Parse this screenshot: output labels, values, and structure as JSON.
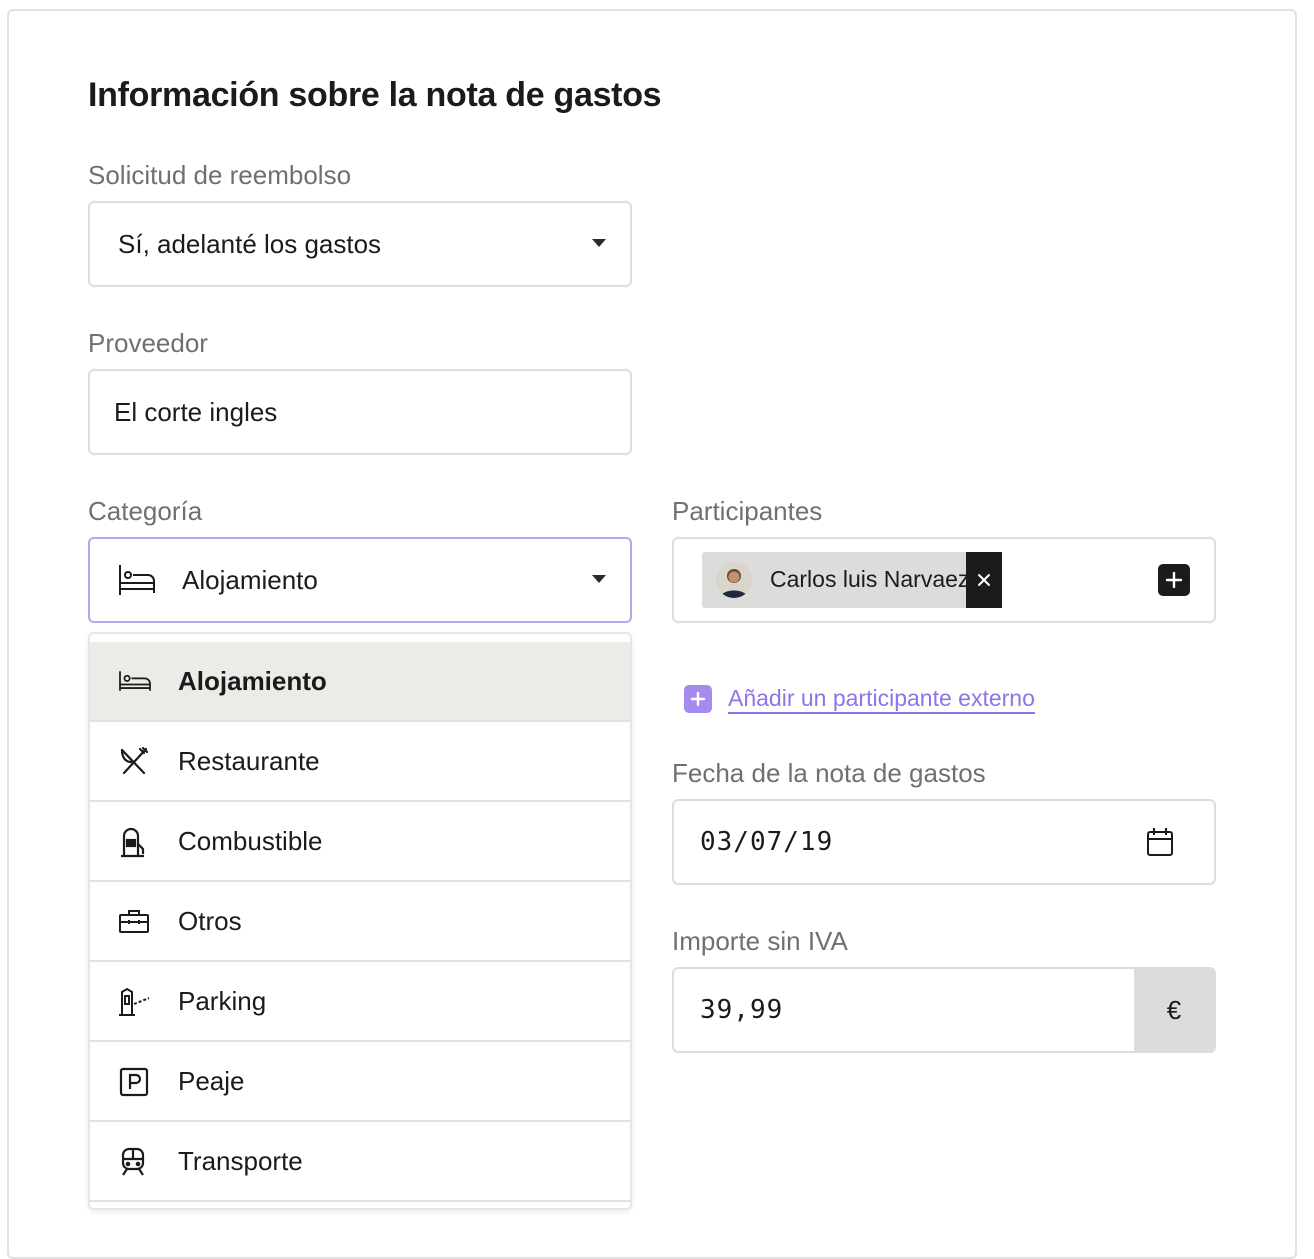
{
  "form": {
    "title": "Información sobre la nota de gastos",
    "reimbursement": {
      "label": "Solicitud de reembolso",
      "value": "Sí, adelanté los gastos"
    },
    "provider": {
      "label": "Proveedor",
      "value": "El corte ingles"
    },
    "category": {
      "label": "Categoría",
      "value": "Alojamiento",
      "icon": "bed-icon",
      "options": [
        {
          "label": "Alojamiento",
          "icon": "bed-icon",
          "selected": true
        },
        {
          "label": "Restaurante",
          "icon": "fork-knife-icon",
          "selected": false
        },
        {
          "label": "Combustible",
          "icon": "fuel-pump-icon",
          "selected": false
        },
        {
          "label": "Otros",
          "icon": "briefcase-icon",
          "selected": false
        },
        {
          "label": "Parking",
          "icon": "parking-barrier-icon",
          "selected": false
        },
        {
          "label": "Peaje",
          "icon": "parking-sign-icon",
          "selected": false
        },
        {
          "label": "Transporte",
          "icon": "train-icon",
          "selected": false
        }
      ]
    },
    "participants": {
      "label": "Participantes",
      "chips": [
        {
          "name": "Carlos luis Narvaez"
        }
      ],
      "add_external_label": "Añadir un participante externo"
    },
    "date": {
      "label": "Fecha de la nota de gastos",
      "value": "03/07/19"
    },
    "amount": {
      "label": "Importe sin IVA",
      "value": "39,99",
      "currency": "€"
    }
  },
  "colors": {
    "accent": "#a58bf0",
    "link": "#8f73e8",
    "focus_border": "#b7a8ee",
    "selected_bg": "#ebebe8"
  }
}
